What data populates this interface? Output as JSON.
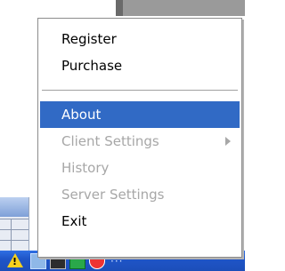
{
  "menu": {
    "items": [
      {
        "label": "Register",
        "state": "enabled"
      },
      {
        "label": "Purchase",
        "state": "enabled"
      },
      {
        "label": "About",
        "state": "selected"
      },
      {
        "label": "Client Settings",
        "state": "disabled",
        "has_submenu": true
      },
      {
        "label": "History",
        "state": "disabled"
      },
      {
        "label": "Server Settings",
        "state": "disabled"
      },
      {
        "label": "Exit",
        "state": "enabled"
      }
    ],
    "highlight_color": "#316ac5",
    "disabled_color": "#a7a7a7"
  },
  "tray": {
    "icons": [
      "warning-icon",
      "network-icon",
      "monitor-icon",
      "green-app-icon",
      "shield-icon"
    ]
  }
}
